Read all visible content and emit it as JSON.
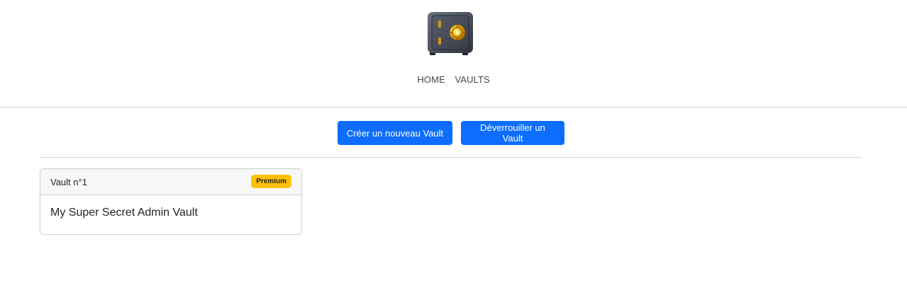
{
  "nav": {
    "items": [
      "HOME",
      "VAULTS"
    ]
  },
  "logo": {
    "icon": "safe-icon"
  },
  "actions": {
    "create_label": "Créer un nouveau Vault",
    "unlock_label": "Déverrouiller un Vault"
  },
  "vaults": [
    {
      "header": "Vault n°1",
      "badge": "Premium",
      "name": "My Super Secret Admin Vault"
    }
  ],
  "colors": {
    "primary": "#0d6efd",
    "badge": "#ffc107"
  }
}
